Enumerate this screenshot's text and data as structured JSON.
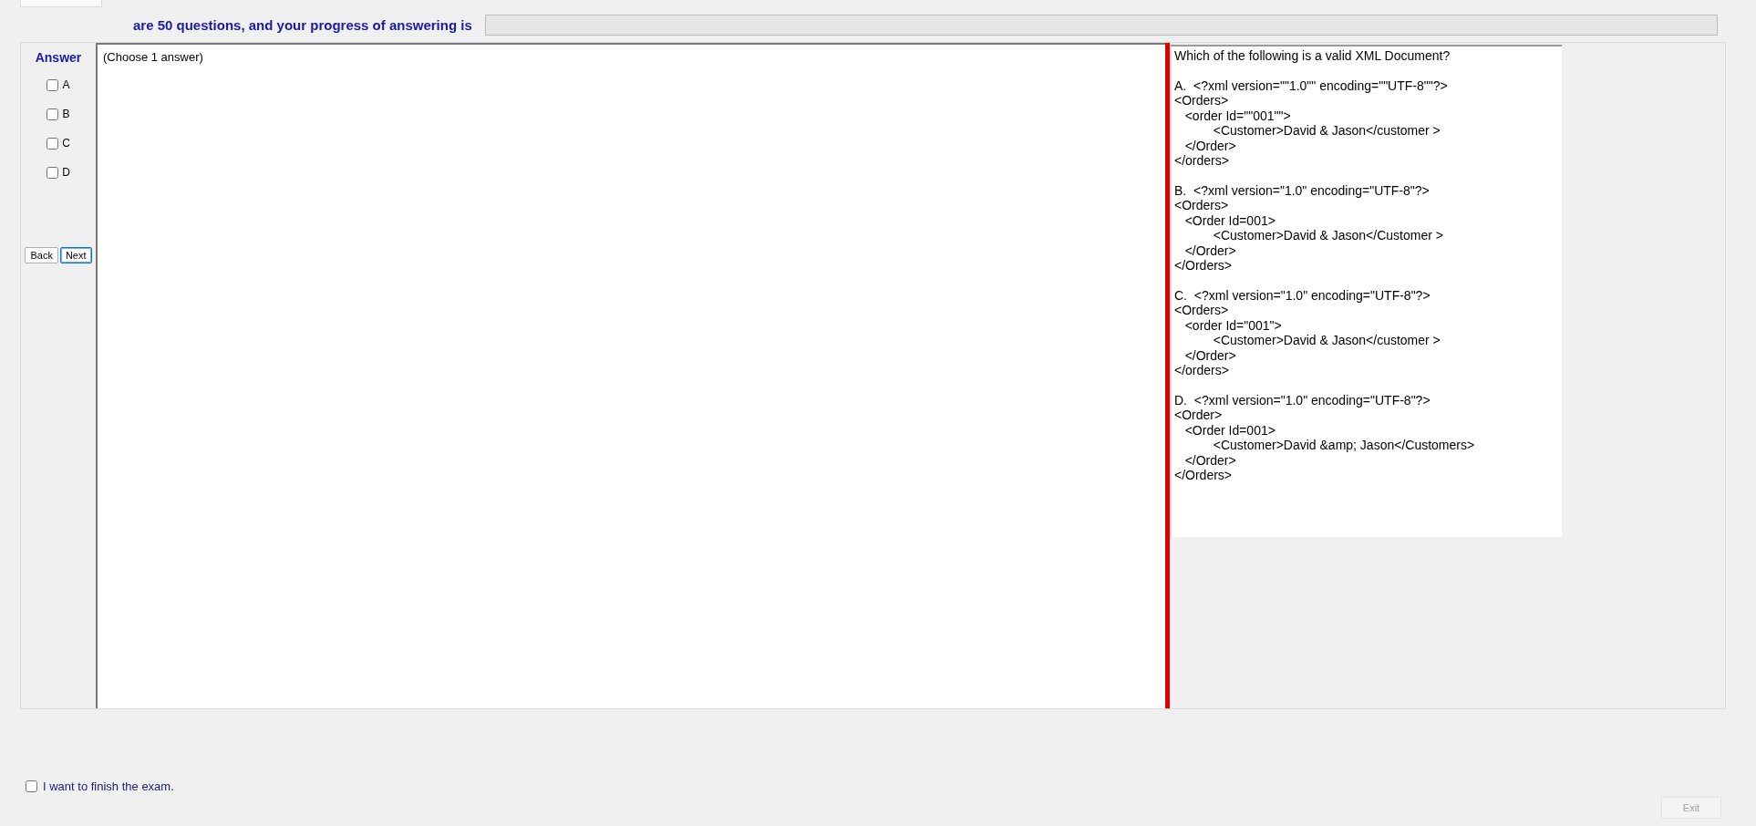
{
  "header": {
    "text": "are 50 questions, and your progress of answering is",
    "progress": {
      "level": 0
    }
  },
  "answer_panel": {
    "title": "Answer",
    "choices": [
      {
        "label": "A",
        "checked": false
      },
      {
        "label": "B",
        "checked": false
      },
      {
        "label": "C",
        "checked": false
      },
      {
        "label": "D",
        "checked": false
      }
    ],
    "buttons": [
      {
        "label": "Back",
        "focused": false
      },
      {
        "label": "Next",
        "focused": true
      }
    ]
  },
  "answer_area": {
    "text": "(Choose 1 answer)"
  },
  "question": {
    "prompt": "Which of the following is a valid XML Document?",
    "options": [
      "A.  <?xml version=\"\"1.0\"\" encoding=\"\"UTF-8\"\"?>\n<Orders>\n   <order Id=\"\"001\"\">\n           <Customer>David & Jason</customer >\n   </Order>\n</orders>",
      "B.  <?xml version=\"1.0\" encoding=\"UTF-8\"?>\n<Orders>\n   <Order Id=001>\n           <Customer>David & Jason</Customer >\n   </Order>\n</Orders>",
      "C.  <?xml version=\"1.0\" encoding=\"UTF-8\"?>\n<Orders>\n   <order Id=\"001\">\n           <Customer>David & Jason</customer >\n   </Order>\n</orders>",
      "D.  <?xml version=\"1.0\" encoding=\"UTF-8\"?>\n<Order>\n   <Order Id=001>\n           <Customer>David &amp; Jason</Customers>\n   </Order>\n</Orders>"
    ]
  },
  "finish": {
    "label": "I want to finish the exam.",
    "checked": false
  },
  "exit_button": {
    "label": "Exit",
    "disabled": true
  }
}
